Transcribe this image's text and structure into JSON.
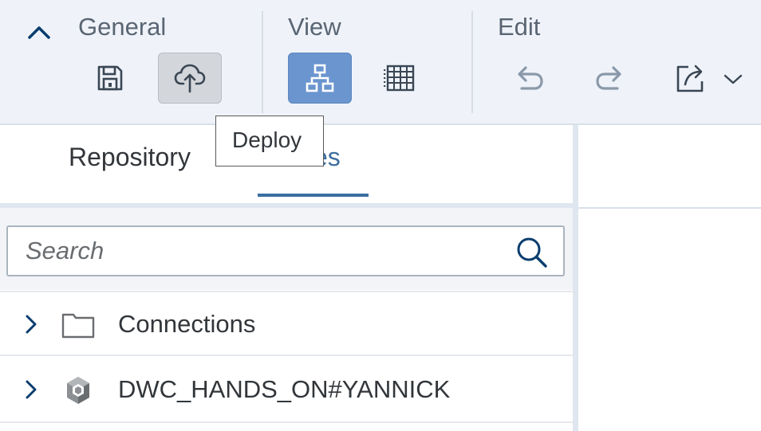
{
  "toolbar": {
    "groups": {
      "general": "General",
      "view": "View",
      "edit": "Edit"
    },
    "icons": {
      "collapse": "chevron-up-icon",
      "save": "save-icon",
      "deploy": "cloud-upload-icon",
      "graphical_view": "hierarchy-icon",
      "table_view": "grid-table-icon",
      "undo": "undo-icon",
      "redo": "redo-icon",
      "share": "share-icon",
      "share_menu": "chevron-down-icon"
    },
    "deploy_state": "pressed",
    "graphical_view_state": "selected"
  },
  "tooltip": {
    "text": "Deploy"
  },
  "left_panel": {
    "tabs": [
      {
        "label": "Repository",
        "selected": false
      },
      {
        "label": "ces",
        "selected": true
      }
    ],
    "search": {
      "placeholder": "Search",
      "value": ""
    },
    "tree": [
      {
        "label": "Connections",
        "icon": "folder-icon",
        "expanded": false
      },
      {
        "label": "DWC_HANDS_ON#YANNICK",
        "icon": "cube-icon",
        "expanded": false
      }
    ]
  },
  "colors": {
    "toolbar_bg": "#eff3f9",
    "accent": "#3b6ea1",
    "selected_button": "#6a95cf",
    "pressed_button": "#d3d6da",
    "text": "#32363a"
  }
}
